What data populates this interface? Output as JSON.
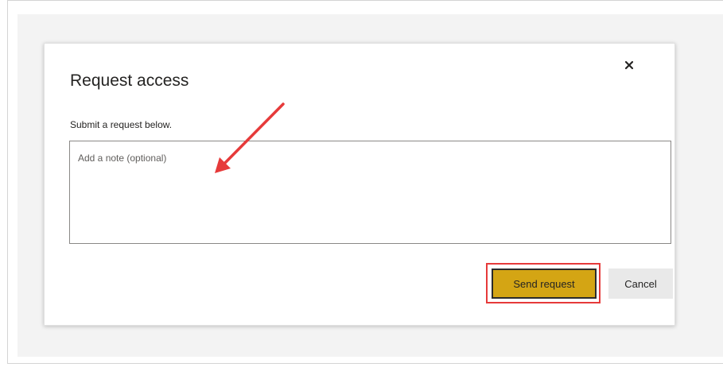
{
  "dialog": {
    "title": "Request access",
    "subtitle": "Submit a request below.",
    "close_icon": "close-icon",
    "note": {
      "placeholder": "Add a note (optional)",
      "value": ""
    },
    "buttons": {
      "send_label": "Send request",
      "cancel_label": "Cancel"
    }
  },
  "colors": {
    "send_button": "#d4a514",
    "cancel_button": "#e9e9e9",
    "annotation": "#e63a3a",
    "backdrop": "#f3f3f3"
  },
  "annotations": {
    "arrow": "annotation-arrow",
    "highlight": "send-request-highlight"
  }
}
